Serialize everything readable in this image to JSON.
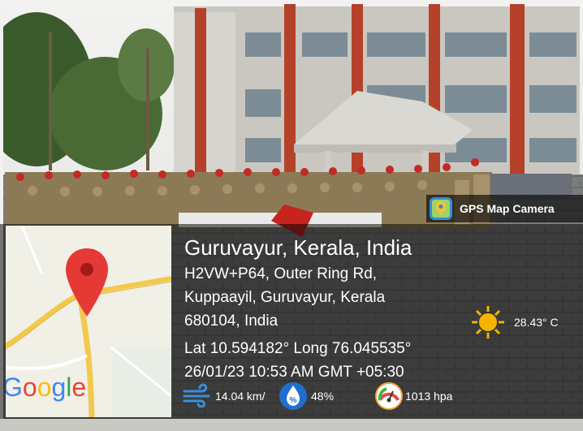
{
  "badge": {
    "label": "GPS Map Camera",
    "icon": "gps-map-camera-icon"
  },
  "map": {
    "brand": "Google",
    "brand_colors": [
      "#4285F4",
      "#EA4335",
      "#FBBC05",
      "#4285F4",
      "#34A853",
      "#EA4335"
    ],
    "pin_color": "#E53935"
  },
  "location": {
    "title": "Guruvayur, Kerala, India",
    "address_lines": [
      "H2VW+P64, Outer Ring Rd,",
      "Kuppaayil, Guruvayur, Kerala",
      "680104, India"
    ],
    "coordinates": "Lat 10.594182° Long 76.045535°",
    "datetime": "26/01/23 10:53 AM GMT +05:30"
  },
  "weather": {
    "temperature": "28.43° C",
    "wind": "14.04 km/",
    "humidity": "48%",
    "pressure": "1013 hpa"
  }
}
